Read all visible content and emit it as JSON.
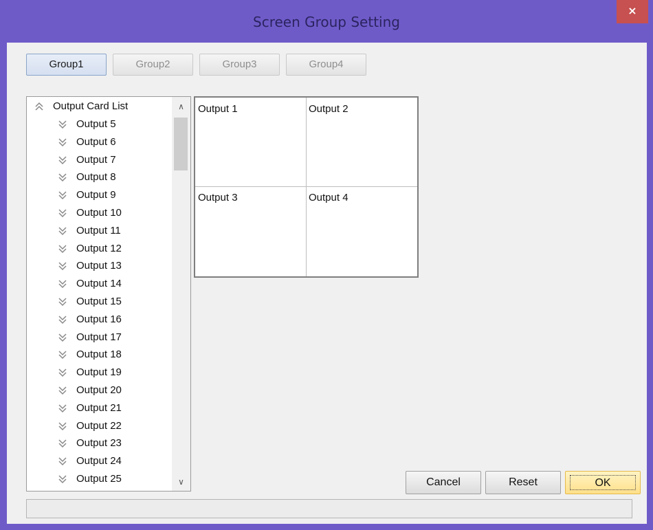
{
  "window": {
    "title": "Screen Group Setting",
    "close_glyph": "×",
    "frame_color": "#6f5bc8",
    "close_color": "#c75050"
  },
  "groups": {
    "tabs": [
      {
        "label": "Group1",
        "active": true
      },
      {
        "label": "Group2",
        "active": false
      },
      {
        "label": "Group3",
        "active": false
      },
      {
        "label": "Group4",
        "active": false
      }
    ]
  },
  "tree": {
    "root": {
      "label": "Output Card List",
      "icon": "collapse-chevrons-icon"
    },
    "items": [
      {
        "label": "Output 5"
      },
      {
        "label": "Output 6"
      },
      {
        "label": "Output 7"
      },
      {
        "label": "Output 8"
      },
      {
        "label": "Output 9"
      },
      {
        "label": "Output 10"
      },
      {
        "label": "Output 11"
      },
      {
        "label": "Output 12"
      },
      {
        "label": "Output 13"
      },
      {
        "label": "Output 14"
      },
      {
        "label": "Output 15"
      },
      {
        "label": "Output 16"
      },
      {
        "label": "Output 17"
      },
      {
        "label": "Output 18"
      },
      {
        "label": "Output 19"
      },
      {
        "label": "Output 20"
      },
      {
        "label": "Output 21"
      },
      {
        "label": "Output 22"
      },
      {
        "label": "Output 23"
      },
      {
        "label": "Output 24"
      },
      {
        "label": "Output 25"
      }
    ],
    "item_icon": "expand-chevrons-icon",
    "scroll_up": "∧",
    "scroll_down": "∨"
  },
  "grid": {
    "cells": [
      {
        "label": "Output 1"
      },
      {
        "label": "Output 2"
      },
      {
        "label": "Output 3"
      },
      {
        "label": "Output 4"
      }
    ]
  },
  "buttons": {
    "cancel": "Cancel",
    "reset": "Reset",
    "ok": "OK"
  },
  "status": {
    "text": ""
  }
}
